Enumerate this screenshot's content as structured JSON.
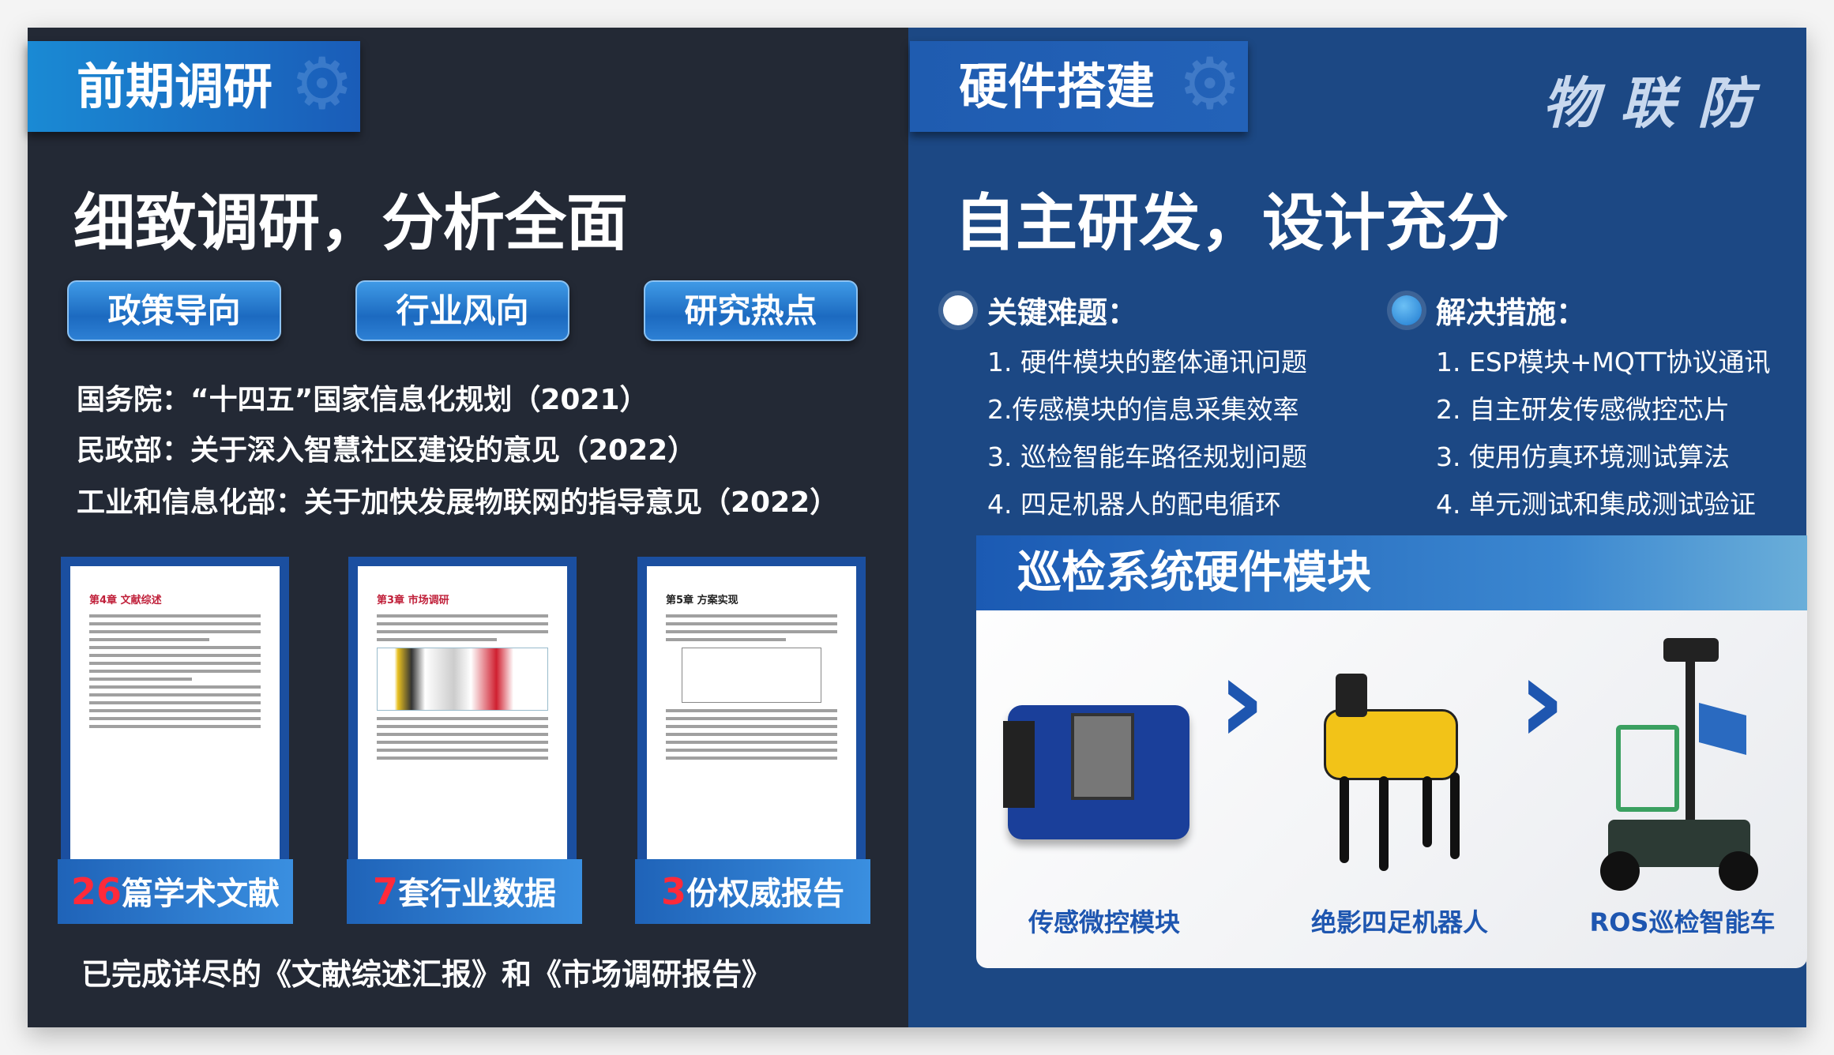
{
  "left": {
    "tab": "前期调研",
    "title": "细致调研，分析全面",
    "buttons": [
      "政策导向",
      "行业风向",
      "研究热点"
    ],
    "policies": [
      "国务院：“十四五”国家信息化规划（2021）",
      "民政部：关于深入智慧社区建设的意见（2022）",
      "工业和信息化部：关于加快发展物联网的指导意见（2022）"
    ],
    "docs": [
      {
        "chapter": "第4章 文献综述",
        "num": "26",
        "label": "篇学术文献"
      },
      {
        "chapter": "第3章 市场调研",
        "num": "7",
        "label": "套行业数据"
      },
      {
        "chapter": "第5章 方案实现",
        "num": "3",
        "label": "份权威报告"
      }
    ],
    "summary": "已完成详尽的《文献综述汇报》和《市场调研报告》"
  },
  "right": {
    "tab": "硬件搭建",
    "brand": "物联防",
    "title": "自主研发，设计充分",
    "problems": {
      "heading": "关键难题：",
      "items": [
        "1. 硬件模块的整体通讯问题",
        "2.传感模块的信息采集效率",
        "3. 巡检智能车路径规划问题",
        "4. 四足机器人的配电循环"
      ]
    },
    "solutions": {
      "heading": "解决措施：",
      "items": [
        "1. ESP模块+MQTT协议通讯",
        "2. 自主研发传感微控芯片",
        "3. 使用仿真环境测试算法",
        "4. 单元测试和集成测试验证"
      ]
    },
    "module": {
      "title": "巡检系统硬件模块",
      "labels": [
        "传感微控模块",
        "绝影四足机器人",
        "ROS巡检智能车"
      ]
    }
  },
  "colors": {
    "left_bg": "#232935",
    "right_bg": "#1c4884",
    "accent": "#1e56b0",
    "highlight": "#ff2a3a"
  }
}
